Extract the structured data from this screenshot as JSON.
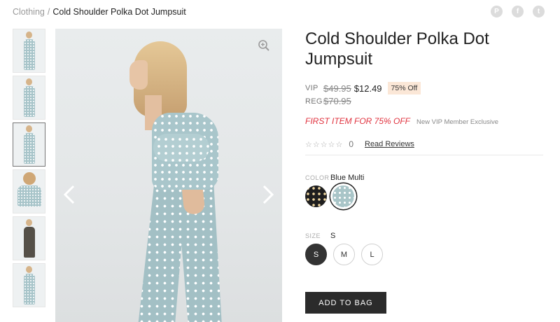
{
  "breadcrumb": {
    "parent": "Clothing",
    "separator": "/",
    "current": "Cold Shoulder Polka Dot Jumpsuit"
  },
  "social": [
    {
      "icon": "pinterest-icon",
      "glyph": "P"
    },
    {
      "icon": "facebook-icon",
      "glyph": "f"
    },
    {
      "icon": "twitter-icon",
      "glyph": "t"
    }
  ],
  "gallery": {
    "thumbnail_count": 6,
    "active_index": 2
  },
  "product": {
    "title": "Cold Shoulder Polka Dot Jumpsuit",
    "vip_label": "VIP",
    "vip_original": "$49.95",
    "vip_price": "$12.49",
    "discount_badge": "75% Off",
    "reg_label": "REG",
    "reg_price": "$70.95",
    "promo": "FIRST ITEM FOR 75% OFF",
    "promo_note": "New VIP Member Exclusive",
    "stars": "☆☆☆☆☆",
    "rating": 0,
    "review_count": "0",
    "read_reviews": "Read Reviews"
  },
  "color": {
    "label": "COLOR",
    "selected": "Blue Multi",
    "swatches": [
      {
        "name": "black-polka-dot",
        "hex": "#1f1f1f"
      },
      {
        "name": "blue-multi",
        "hex": "#a9c5c8"
      }
    ]
  },
  "size": {
    "label": "SIZE",
    "selected": "S",
    "options": [
      "S",
      "M",
      "L"
    ]
  },
  "cta": {
    "add_to_bag": "ADD TO BAG"
  }
}
